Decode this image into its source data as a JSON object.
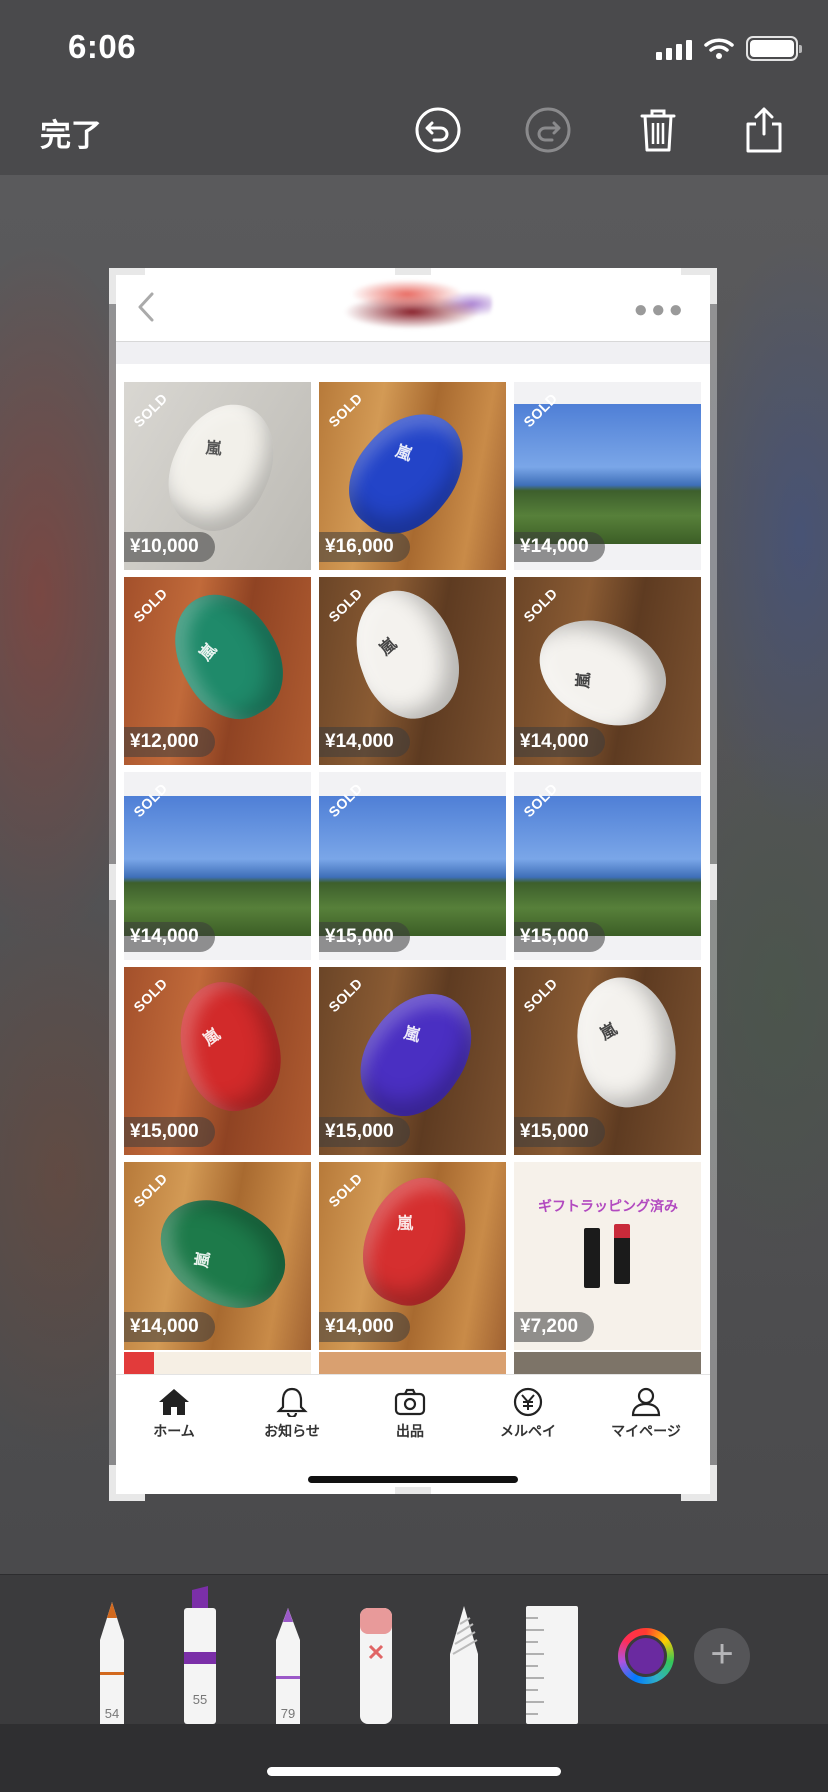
{
  "status_bar": {
    "time": "6:06"
  },
  "toolbar": {
    "done_label": "完了",
    "icons": [
      "undo-icon",
      "redo-icon",
      "trash-icon",
      "share-icon"
    ]
  },
  "screenshot": {
    "header": {
      "back_icon": "chevron-left-icon",
      "more_icon": "ellipsis-icon"
    },
    "items": [
      {
        "price": "¥10,000",
        "sold": "SOLD",
        "image": "white-balloon"
      },
      {
        "price": "¥16,000",
        "sold": "SOLD",
        "image": "blue-balloon"
      },
      {
        "price": "¥14,000",
        "sold": "SOLD",
        "image": "sky-view"
      },
      {
        "price": "¥12,000",
        "sold": "SOLD",
        "image": "green-balloon"
      },
      {
        "price": "¥14,000",
        "sold": "SOLD",
        "image": "white-balloon"
      },
      {
        "price": "¥14,000",
        "sold": "SOLD",
        "image": "white-balloon"
      },
      {
        "price": "¥14,000",
        "sold": "SOLD",
        "image": "sky-view"
      },
      {
        "price": "¥15,000",
        "sold": "SOLD",
        "image": "sky-view"
      },
      {
        "price": "¥15,000",
        "sold": "SOLD",
        "image": "sky-view"
      },
      {
        "price": "¥15,000",
        "sold": "SOLD",
        "image": "red-balloon"
      },
      {
        "price": "¥15,000",
        "sold": "SOLD",
        "image": "purple-balloon"
      },
      {
        "price": "¥15,000",
        "sold": "SOLD",
        "image": "white-balloon"
      },
      {
        "price": "¥14,000",
        "sold": "SOLD",
        "image": "green-balloon"
      },
      {
        "price": "¥14,000",
        "sold": "SOLD",
        "image": "red-balloon"
      },
      {
        "price": "¥7,200",
        "sold": "",
        "image": "lipstick-ad"
      }
    ],
    "ad_text": "ギフトラッピング済み",
    "tabs": [
      {
        "label": "ホーム",
        "icon": "home-icon"
      },
      {
        "label": "お知らせ",
        "icon": "bell-icon"
      },
      {
        "label": "出品",
        "icon": "camera-icon"
      },
      {
        "label": "メルペイ",
        "icon": "yen-icon"
      },
      {
        "label": "マイページ",
        "icon": "person-icon"
      }
    ]
  },
  "markup_tools": {
    "pen_number": "54",
    "marker_number": "55",
    "pencil_number": "79",
    "tools": [
      "pen-tool",
      "marker-tool",
      "pencil-tool",
      "eraser-tool",
      "lasso-tool",
      "ruler-tool"
    ],
    "selected_color": "#6a2aa0",
    "colors": {
      "pen_tip": "#d2691e",
      "marker": "#7b2fa8",
      "pencil": "#9b59c8",
      "eraser": "#e89a9a",
      "sold_ribbon": "#e23b3b"
    }
  }
}
